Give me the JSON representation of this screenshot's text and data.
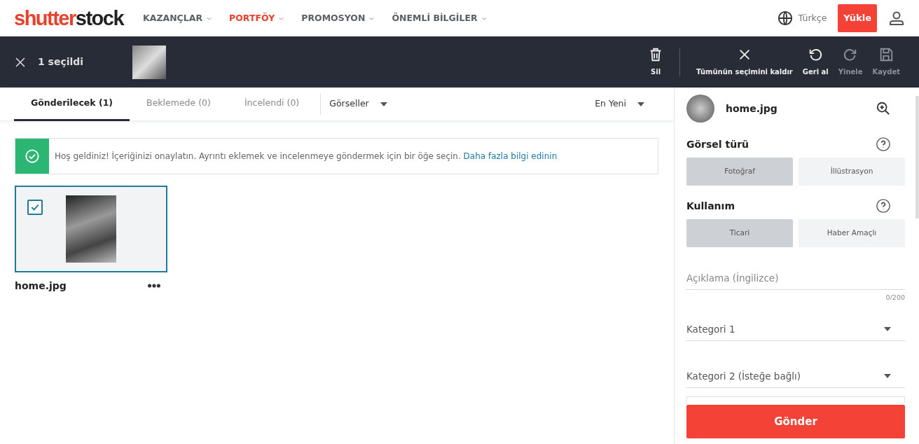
{
  "logo": [
    {
      "text": "shutter",
      "color": "#e8412c"
    },
    {
      "text": "stock",
      "color": "#222222"
    }
  ],
  "nav": [
    {
      "label": "KAZANÇLAR",
      "selected": false
    },
    {
      "label": "PORTFÖY",
      "selected": true
    },
    {
      "label": "PROMOSYON",
      "selected": false
    },
    {
      "label": "ÖNEMLİ BİLGİLER",
      "selected": false
    }
  ],
  "language": "Türkçe",
  "upload_button": "Yükle",
  "selection_bar": {
    "count": "1 seçildi",
    "actions": [
      {
        "kind": "trash",
        "label": "Sil",
        "disabled": false
      },
      {
        "kind": "close",
        "label": "Tümünün seçimini kaldır",
        "disabled": false
      },
      {
        "kind": "undo",
        "label": "Geri al",
        "disabled": false
      },
      {
        "kind": "redo",
        "label": "Yinele",
        "disabled": true
      },
      {
        "kind": "save",
        "label": "Kaydet",
        "disabled": true
      }
    ]
  },
  "tabs": [
    {
      "label": "Gönderilecek (1)",
      "selected": true
    },
    {
      "label": "Beklemede (0)",
      "selected": false
    },
    {
      "label": "İncelendi (0)",
      "selected": false
    }
  ],
  "type_filter": "Görseller",
  "sort": "En Yeni",
  "alert": {
    "text": "Hoş geldiniz! İçeriğinizi onaylatın. Ayrıntı eklemek ve incelenmeye göndermek için bir öğe seçin.",
    "link": "Daha fazla bilgi edinin"
  },
  "items": [
    {
      "filename": "home.jpg",
      "checked": true
    }
  ],
  "details": {
    "filename": "home.jpg",
    "sections": [
      {
        "title": "Görsel türü",
        "options": [
          {
            "label": "Fotoğraf",
            "selected": true
          },
          {
            "label": "İllüstrasyon",
            "selected": false
          }
        ]
      },
      {
        "title": "Kullanım",
        "options": [
          {
            "label": "Ticari",
            "selected": true
          },
          {
            "label": "Haber Amaçlı",
            "selected": false
          }
        ]
      }
    ],
    "description": {
      "placeholder": "Açıklama (İngilizce)",
      "counter": "0/200"
    },
    "categories": [
      "Kategori 1",
      "Kategori 2 (İsteğe bağlı)"
    ],
    "submit": "Gönder"
  }
}
